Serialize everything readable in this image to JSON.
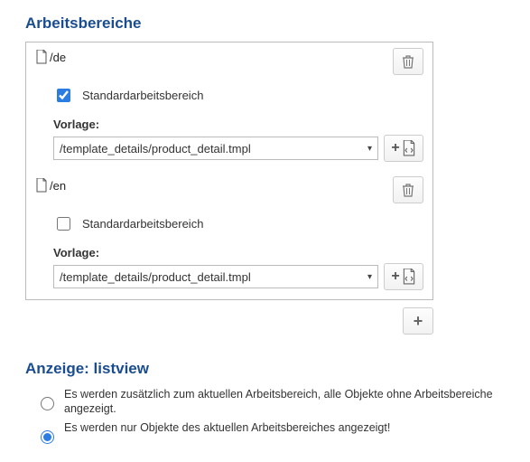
{
  "sections": {
    "workspaces_title": "Arbeitsbereiche",
    "anzeige_title": "Anzeige: listview"
  },
  "workspaces": [
    {
      "path": "/de",
      "standard_label": "Standardarbeitsbereich",
      "standard_checked": true,
      "vorlage_label": "Vorlage:",
      "vorlage_value": "/template_details/product_detail.tmpl"
    },
    {
      "path": "/en",
      "standard_label": "Standardarbeitsbereich",
      "standard_checked": false,
      "vorlage_label": "Vorlage:",
      "vorlage_value": "/template_details/product_detail.tmpl"
    }
  ],
  "anzeige": {
    "options": [
      {
        "label": "Es werden zusätzlich zum aktuellen Arbeitsbereich, alle Objekte ohne Arbeitsbereiche angezeigt.",
        "checked": false
      },
      {
        "label": "Es werden nur Objekte des aktuellen Arbeitsbereiches angezeigt!",
        "checked": true
      }
    ]
  }
}
